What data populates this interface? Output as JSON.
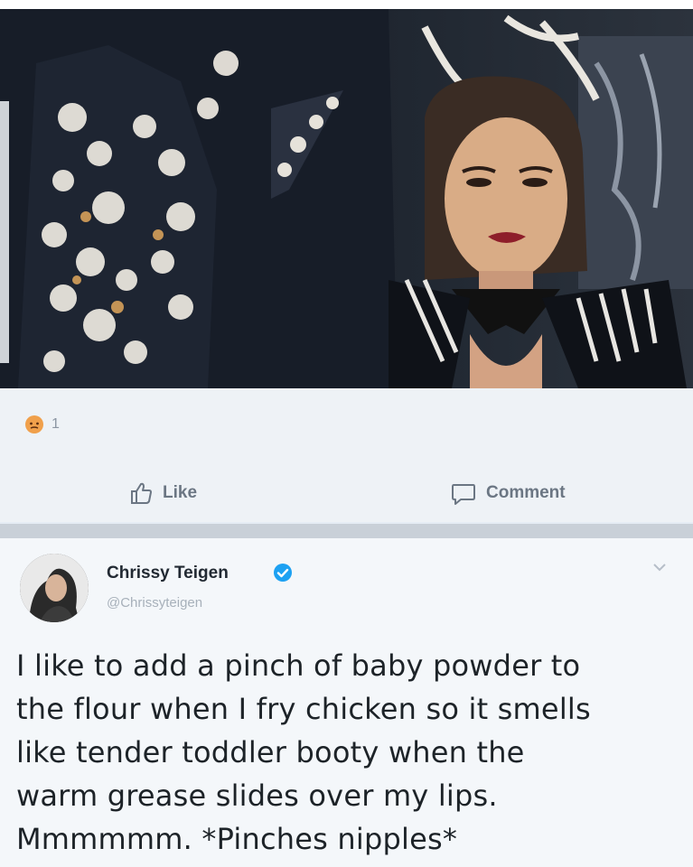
{
  "reactions": {
    "emoji_icon": "angry-face-icon",
    "count": "1"
  },
  "actions": {
    "like_label": "Like",
    "comment_label": "Comment"
  },
  "tweet": {
    "author_name": "Chrissy Teigen",
    "author_handle": "@Chrissyteigen",
    "verified": true,
    "text": "I like to add a pinch of baby powder to\nthe flour when I fry chicken so it smells\nlike tender toddler booty when the\nwarm grease slides over my lips.\nMmmmmm. *Pinches nipples*"
  },
  "colors": {
    "action_gray": "#6b7683",
    "verified_blue": "#1da1f2",
    "reaction_orange": "#f0a04b"
  }
}
